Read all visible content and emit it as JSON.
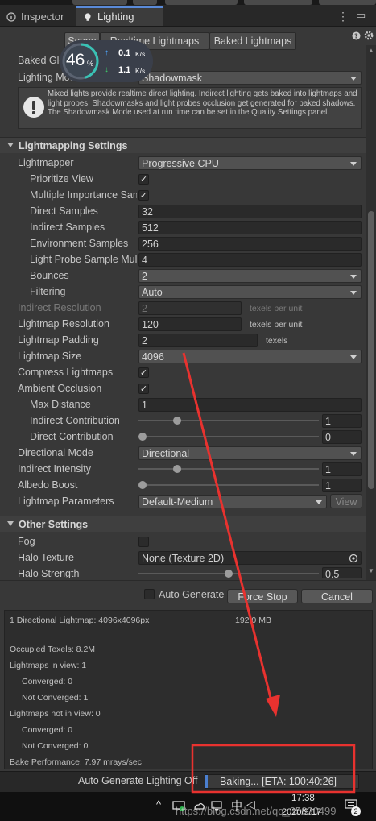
{
  "tabs": {
    "inspector": "Inspector",
    "lighting": "Lighting"
  },
  "scene_tabs": [
    "Scene",
    "Realtime Lightmaps",
    "Baked Lightmaps"
  ],
  "perf_overlay": {
    "percent": "46",
    "percent_sign": "%",
    "up": "0.1",
    "down": "1.1",
    "unit": "K/s"
  },
  "mixed_lighting": {
    "baked_gi_label": "Baked Global Illumination",
    "lighting_mode_label": "Lighting Mode",
    "lighting_mode_value": "Shadowmask",
    "info": "Mixed lights provide realtime direct lighting. Indirect lighting gets baked into lightmaps and light probes. Shadowmasks and light probes occlusion get generated for baked shadows. The Shadowmask Mode used at run time can be set in the Quality Settings panel."
  },
  "lightmapping": {
    "title": "Lightmapping Settings",
    "lightmapper": {
      "label": "Lightmapper",
      "value": "Progressive CPU"
    },
    "prioritize_view": {
      "label": "Prioritize View",
      "checked": true
    },
    "multiple_importance": {
      "label": "Multiple Importance Sampling",
      "checked": true
    },
    "direct_samples": {
      "label": "Direct Samples",
      "value": "32"
    },
    "indirect_samples": {
      "label": "Indirect Samples",
      "value": "512"
    },
    "environment_samples": {
      "label": "Environment Samples",
      "value": "256"
    },
    "light_probe_mult": {
      "label": "Light Probe Sample Multiplier",
      "value": "4"
    },
    "bounces": {
      "label": "Bounces",
      "value": "2"
    },
    "filtering": {
      "label": "Filtering",
      "value": "Auto"
    },
    "indirect_resolution": {
      "label": "Indirect Resolution",
      "value": "2",
      "unit": "texels per unit"
    },
    "lightmap_resolution": {
      "label": "Lightmap Resolution",
      "value": "120",
      "unit": "texels per unit"
    },
    "lightmap_padding": {
      "label": "Lightmap Padding",
      "value": "2",
      "unit": "texels"
    },
    "lightmap_size": {
      "label": "Lightmap Size",
      "value": "4096"
    },
    "compress": {
      "label": "Compress Lightmaps",
      "checked": true
    },
    "ambient_occlusion": {
      "label": "Ambient Occlusion",
      "checked": true
    },
    "max_distance": {
      "label": "Max Distance",
      "value": "1"
    },
    "indirect_contribution": {
      "label": "Indirect Contribution",
      "value": "1",
      "level": 0.2
    },
    "direct_contribution": {
      "label": "Direct Contribution",
      "value": "0",
      "level": 0.0
    },
    "directional_mode": {
      "label": "Directional Mode",
      "value": "Directional"
    },
    "indirect_intensity": {
      "label": "Indirect Intensity",
      "value": "1",
      "level": 0.2
    },
    "albedo_boost": {
      "label": "Albedo Boost",
      "value": "1",
      "level": 0.0
    },
    "lightmap_parameters": {
      "label": "Lightmap Parameters",
      "value": "Default-Medium",
      "view": "View"
    }
  },
  "other": {
    "title": "Other Settings",
    "fog": {
      "label": "Fog",
      "checked": false
    },
    "halo_texture": {
      "label": "Halo Texture",
      "value": "None (Texture 2D)"
    },
    "halo_strength": {
      "label": "Halo Strength",
      "value": "0.5",
      "level": 0.5
    }
  },
  "bake_bar": {
    "auto_generate": "Auto Generate",
    "force_stop": "Force Stop",
    "cancel": "Cancel"
  },
  "stats": {
    "lightmaps": "1 Directional Lightmap: 4096x4096px",
    "memory": "192.0 MB",
    "occupied": "Occupied Texels: 8.2M",
    "in_view": "Lightmaps in view: 1",
    "in_view_converged": "Converged: 0",
    "in_view_not_converged": "Not Converged: 1",
    "not_in_view": "Lightmaps not in view: 0",
    "not_in_view_converged": "Converged: 0",
    "not_in_view_not_converged": "Not Converged: 0",
    "performance": "Bake Performance: 7.97 mrays/sec"
  },
  "status": {
    "auto_off": "Auto Generate Lighting Off",
    "baking": "Baking... [ETA: 100:40:26]"
  },
  "taskbar": {
    "time": "17:38",
    "date": "2020/9/17",
    "watermark": "https://blog.csdn.net/qq_35030499",
    "notif_count": "2"
  },
  "colors": {
    "accent": "#5a8ad8",
    "annotation": "#e8322f"
  }
}
